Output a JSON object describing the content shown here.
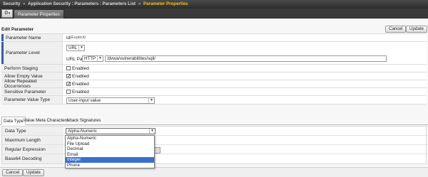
{
  "breadcrumb": {
    "items": [
      "Security",
      "Application Security : Parameters : Parameters List"
    ],
    "current": "Parameter Properties",
    "separator": "»"
  },
  "tabs": {
    "gear_glyph": "⚙",
    "gear_caret": "▾",
    "active": "Parameter Properties"
  },
  "section_title": "Edit Parameter",
  "buttons": {
    "cancel": "Cancel",
    "update": "Update"
  },
  "form": {
    "name": {
      "label": "Parameter Name",
      "value": "id",
      "note": "(Explicit)"
    },
    "level": {
      "label": "Parameter Level",
      "select": "URL",
      "url_path_label": "URL Path",
      "protocol": "HTTP",
      "path": "/dvwa/vulnerabilities/sqli/"
    },
    "staging": {
      "label": "Perform Staging",
      "checkbox": "Enabled",
      "checked": false
    },
    "empty": {
      "label": "Allow Empty Value",
      "checkbox": "Enabled",
      "checked": true
    },
    "repeated": {
      "label": "Allow Repeated Occurrences",
      "checkbox": "Enabled",
      "checked": true
    },
    "sensitive": {
      "label": "Sensitive Parameter",
      "checkbox": "Enabled",
      "checked": false
    },
    "value_type": {
      "label": "Parameter Value Type",
      "select": "User-input value"
    }
  },
  "subtabs": [
    "Data Type",
    "Value Meta Characters",
    "Attack Signatures"
  ],
  "datatype": {
    "label": "Data Type",
    "selected": "Alpha-Numeric",
    "options": [
      "Alpha-Numeric",
      "File Upload",
      "Decimal",
      "Email",
      "Integer",
      "Phone"
    ],
    "highlighted": "Integer",
    "rows": [
      "Maximum Length",
      "Regular Expression",
      "Base64 Decoding"
    ]
  },
  "colors": {
    "accent": "#2a61b8",
    "breadcrumb_current": "#f2c21b",
    "highlight": "#3a6fcf"
  }
}
